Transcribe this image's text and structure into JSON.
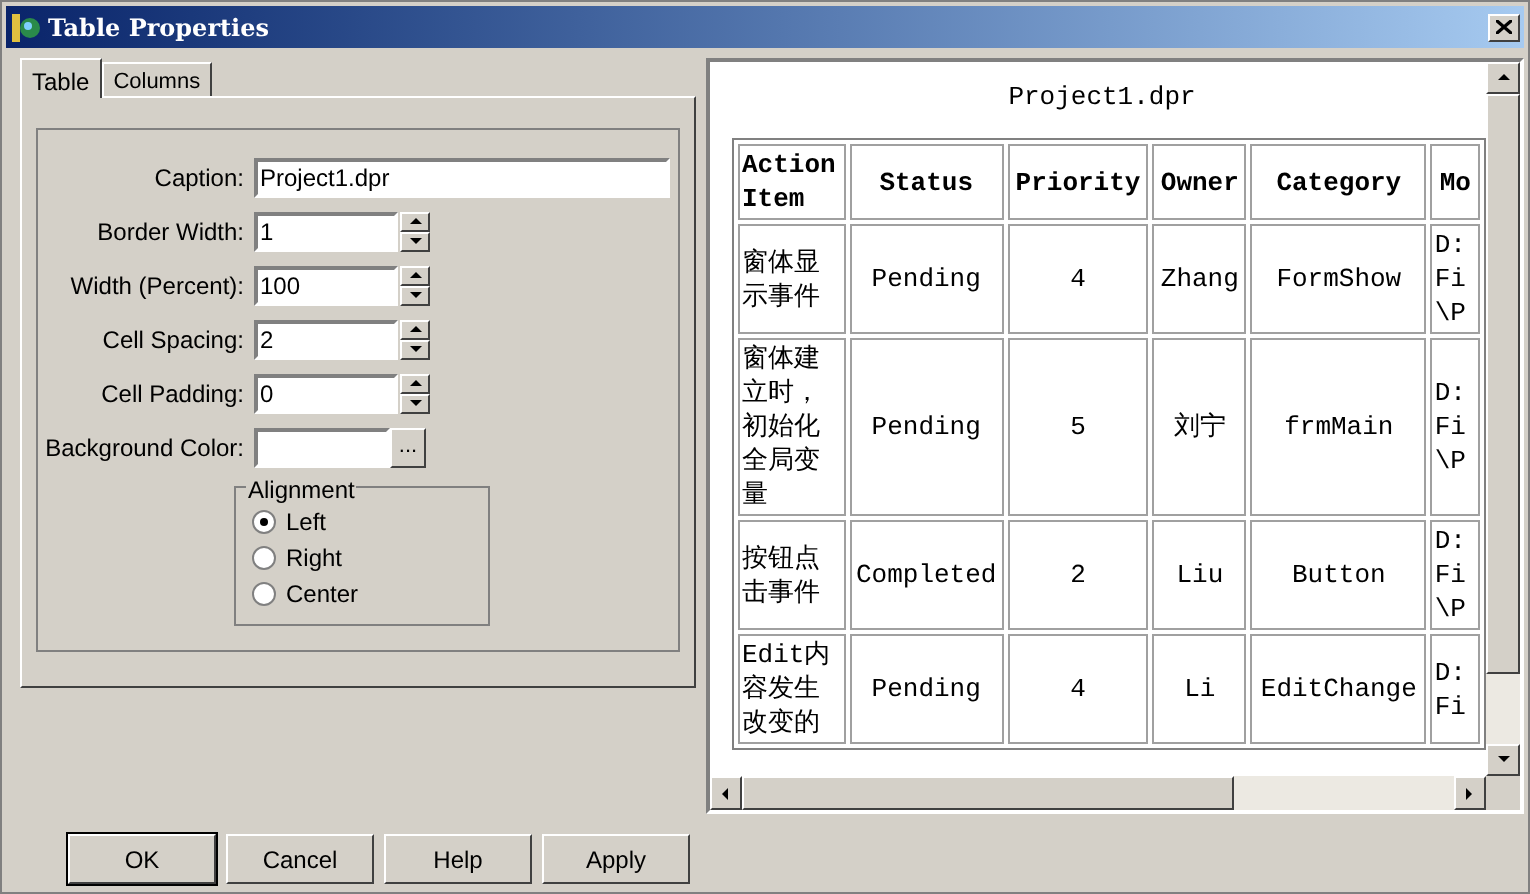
{
  "window": {
    "title": "Table Properties"
  },
  "tabs": [
    {
      "label": "Table",
      "selected": true
    },
    {
      "label": "Columns",
      "selected": false
    }
  ],
  "fields": [
    {
      "kind": "text",
      "label": "Caption:",
      "value": "Project1.dpr"
    },
    {
      "kind": "spin",
      "label": "Border Width:",
      "value": "1"
    },
    {
      "kind": "spin",
      "label": "Width (Percent):",
      "value": "100"
    },
    {
      "kind": "spin",
      "label": "Cell Spacing:",
      "value": "2"
    },
    {
      "kind": "spin",
      "label": "Cell Padding:",
      "value": "0"
    },
    {
      "kind": "color",
      "label": "Background Color:",
      "button": "..."
    }
  ],
  "alignment": {
    "title": "Alignment",
    "options": [
      {
        "label": "Left",
        "selected": true
      },
      {
        "label": "Right",
        "selected": false
      },
      {
        "label": "Center",
        "selected": false
      }
    ]
  },
  "buttons": [
    {
      "label": "OK",
      "default": true
    },
    {
      "label": "Cancel",
      "default": false
    },
    {
      "label": "Help",
      "default": false
    },
    {
      "label": "Apply",
      "default": false
    }
  ],
  "preview": {
    "caption": "Project1.dpr",
    "columns": [
      "Action Item",
      "Status",
      "Priority",
      "Owner",
      "Category",
      "Mo"
    ],
    "rows": [
      [
        "窗体显示事件",
        "Pending",
        "4",
        "Zhang",
        "FormShow",
        "D:Fi\\P"
      ],
      [
        "窗体建立时，初始化全局变量",
        "Pending",
        "5",
        "刘宁",
        "frmMain",
        "D:Fi\\P"
      ],
      [
        "按钮点击事件",
        "Completed",
        "2",
        "Liu",
        "Button",
        "D:Fi\\P"
      ],
      [
        "Edit内容发生改变的",
        "Pending",
        "4",
        "Li",
        "EditChange",
        "D:Fi"
      ]
    ]
  }
}
